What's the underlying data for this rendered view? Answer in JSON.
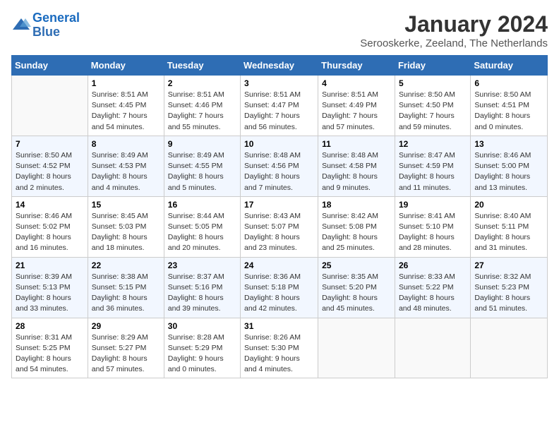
{
  "header": {
    "logo_line1": "General",
    "logo_line2": "Blue",
    "title": "January 2024",
    "subtitle": "Serooskerke, Zeeland, The Netherlands"
  },
  "days_of_week": [
    "Sunday",
    "Monday",
    "Tuesday",
    "Wednesday",
    "Thursday",
    "Friday",
    "Saturday"
  ],
  "weeks": [
    [
      {
        "num": "",
        "empty": true
      },
      {
        "num": "1",
        "sunrise": "Sunrise: 8:51 AM",
        "sunset": "Sunset: 4:45 PM",
        "daylight": "Daylight: 7 hours and 54 minutes."
      },
      {
        "num": "2",
        "sunrise": "Sunrise: 8:51 AM",
        "sunset": "Sunset: 4:46 PM",
        "daylight": "Daylight: 7 hours and 55 minutes."
      },
      {
        "num": "3",
        "sunrise": "Sunrise: 8:51 AM",
        "sunset": "Sunset: 4:47 PM",
        "daylight": "Daylight: 7 hours and 56 minutes."
      },
      {
        "num": "4",
        "sunrise": "Sunrise: 8:51 AM",
        "sunset": "Sunset: 4:49 PM",
        "daylight": "Daylight: 7 hours and 57 minutes."
      },
      {
        "num": "5",
        "sunrise": "Sunrise: 8:50 AM",
        "sunset": "Sunset: 4:50 PM",
        "daylight": "Daylight: 7 hours and 59 minutes."
      },
      {
        "num": "6",
        "sunrise": "Sunrise: 8:50 AM",
        "sunset": "Sunset: 4:51 PM",
        "daylight": "Daylight: 8 hours and 0 minutes."
      }
    ],
    [
      {
        "num": "7",
        "sunrise": "Sunrise: 8:50 AM",
        "sunset": "Sunset: 4:52 PM",
        "daylight": "Daylight: 8 hours and 2 minutes."
      },
      {
        "num": "8",
        "sunrise": "Sunrise: 8:49 AM",
        "sunset": "Sunset: 4:53 PM",
        "daylight": "Daylight: 8 hours and 4 minutes."
      },
      {
        "num": "9",
        "sunrise": "Sunrise: 8:49 AM",
        "sunset": "Sunset: 4:55 PM",
        "daylight": "Daylight: 8 hours and 5 minutes."
      },
      {
        "num": "10",
        "sunrise": "Sunrise: 8:48 AM",
        "sunset": "Sunset: 4:56 PM",
        "daylight": "Daylight: 8 hours and 7 minutes."
      },
      {
        "num": "11",
        "sunrise": "Sunrise: 8:48 AM",
        "sunset": "Sunset: 4:58 PM",
        "daylight": "Daylight: 8 hours and 9 minutes."
      },
      {
        "num": "12",
        "sunrise": "Sunrise: 8:47 AM",
        "sunset": "Sunset: 4:59 PM",
        "daylight": "Daylight: 8 hours and 11 minutes."
      },
      {
        "num": "13",
        "sunrise": "Sunrise: 8:46 AM",
        "sunset": "Sunset: 5:00 PM",
        "daylight": "Daylight: 8 hours and 13 minutes."
      }
    ],
    [
      {
        "num": "14",
        "sunrise": "Sunrise: 8:46 AM",
        "sunset": "Sunset: 5:02 PM",
        "daylight": "Daylight: 8 hours and 16 minutes."
      },
      {
        "num": "15",
        "sunrise": "Sunrise: 8:45 AM",
        "sunset": "Sunset: 5:03 PM",
        "daylight": "Daylight: 8 hours and 18 minutes."
      },
      {
        "num": "16",
        "sunrise": "Sunrise: 8:44 AM",
        "sunset": "Sunset: 5:05 PM",
        "daylight": "Daylight: 8 hours and 20 minutes."
      },
      {
        "num": "17",
        "sunrise": "Sunrise: 8:43 AM",
        "sunset": "Sunset: 5:07 PM",
        "daylight": "Daylight: 8 hours and 23 minutes."
      },
      {
        "num": "18",
        "sunrise": "Sunrise: 8:42 AM",
        "sunset": "Sunset: 5:08 PM",
        "daylight": "Daylight: 8 hours and 25 minutes."
      },
      {
        "num": "19",
        "sunrise": "Sunrise: 8:41 AM",
        "sunset": "Sunset: 5:10 PM",
        "daylight": "Daylight: 8 hours and 28 minutes."
      },
      {
        "num": "20",
        "sunrise": "Sunrise: 8:40 AM",
        "sunset": "Sunset: 5:11 PM",
        "daylight": "Daylight: 8 hours and 31 minutes."
      }
    ],
    [
      {
        "num": "21",
        "sunrise": "Sunrise: 8:39 AM",
        "sunset": "Sunset: 5:13 PM",
        "daylight": "Daylight: 8 hours and 33 minutes."
      },
      {
        "num": "22",
        "sunrise": "Sunrise: 8:38 AM",
        "sunset": "Sunset: 5:15 PM",
        "daylight": "Daylight: 8 hours and 36 minutes."
      },
      {
        "num": "23",
        "sunrise": "Sunrise: 8:37 AM",
        "sunset": "Sunset: 5:16 PM",
        "daylight": "Daylight: 8 hours and 39 minutes."
      },
      {
        "num": "24",
        "sunrise": "Sunrise: 8:36 AM",
        "sunset": "Sunset: 5:18 PM",
        "daylight": "Daylight: 8 hours and 42 minutes."
      },
      {
        "num": "25",
        "sunrise": "Sunrise: 8:35 AM",
        "sunset": "Sunset: 5:20 PM",
        "daylight": "Daylight: 8 hours and 45 minutes."
      },
      {
        "num": "26",
        "sunrise": "Sunrise: 8:33 AM",
        "sunset": "Sunset: 5:22 PM",
        "daylight": "Daylight: 8 hours and 48 minutes."
      },
      {
        "num": "27",
        "sunrise": "Sunrise: 8:32 AM",
        "sunset": "Sunset: 5:23 PM",
        "daylight": "Daylight: 8 hours and 51 minutes."
      }
    ],
    [
      {
        "num": "28",
        "sunrise": "Sunrise: 8:31 AM",
        "sunset": "Sunset: 5:25 PM",
        "daylight": "Daylight: 8 hours and 54 minutes."
      },
      {
        "num": "29",
        "sunrise": "Sunrise: 8:29 AM",
        "sunset": "Sunset: 5:27 PM",
        "daylight": "Daylight: 8 hours and 57 minutes."
      },
      {
        "num": "30",
        "sunrise": "Sunrise: 8:28 AM",
        "sunset": "Sunset: 5:29 PM",
        "daylight": "Daylight: 9 hours and 0 minutes."
      },
      {
        "num": "31",
        "sunrise": "Sunrise: 8:26 AM",
        "sunset": "Sunset: 5:30 PM",
        "daylight": "Daylight: 9 hours and 4 minutes."
      },
      {
        "num": "",
        "empty": true
      },
      {
        "num": "",
        "empty": true
      },
      {
        "num": "",
        "empty": true
      }
    ]
  ]
}
